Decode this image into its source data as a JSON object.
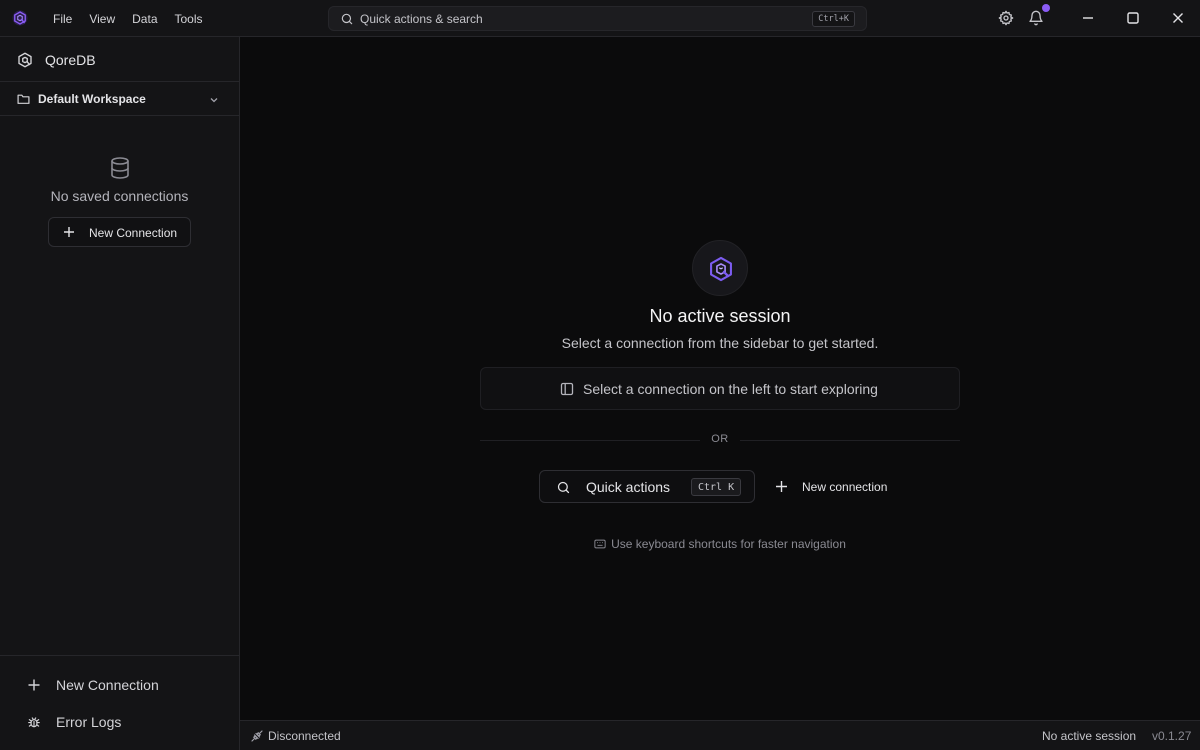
{
  "titlebar": {
    "menu": [
      "File",
      "View",
      "Data",
      "Tools"
    ],
    "search_label": "Quick actions & search",
    "search_shortcut": "Ctrl+K"
  },
  "sidebar": {
    "app_name": "QoreDB",
    "workspace_name": "Default Workspace",
    "empty_text": "No saved connections",
    "new_connection_label": "New Connection",
    "footer": {
      "new_connection_label": "New Connection",
      "error_logs_label": "Error Logs"
    }
  },
  "main": {
    "title": "No active session",
    "subtitle": "Select a connection from the sidebar to get started.",
    "hint": "Select a connection on the left to start exploring",
    "or_text": "OR",
    "quick_actions_label": "Quick actions",
    "quick_actions_shortcut": "Ctrl K",
    "new_connection_label": "New connection",
    "keyboard_hint": "Use keyboard shortcuts for faster navigation"
  },
  "statusbar": {
    "connection_status": "Disconnected",
    "session_status": "No active session",
    "version": "v0.1.27"
  },
  "colors": {
    "accent": "#8b5cf6",
    "background": "#0b0b0c",
    "panel": "#141416",
    "border": "#26262a"
  },
  "icons": [
    "app-logo-icon",
    "search-icon",
    "settings-icon",
    "bell-icon",
    "minimize-icon",
    "maximize-icon",
    "close-icon",
    "folder-icon",
    "chevron-down-icon",
    "database-icon",
    "plus-icon",
    "bug-icon",
    "sidebar-panel-icon",
    "keyboard-icon",
    "unplug-icon"
  ]
}
